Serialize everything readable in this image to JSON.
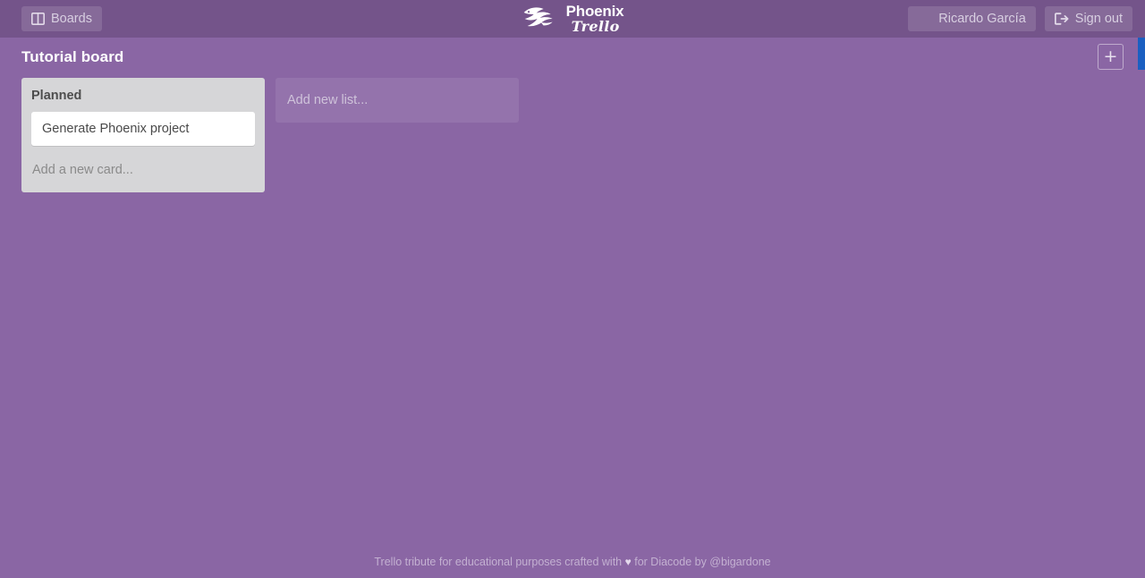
{
  "header": {
    "boards_label": "Boards",
    "boards_icon": "board-columns-icon",
    "logo_phoenix": "Phoenix",
    "logo_trello": "Trello",
    "logo_icon": "phoenix-bird-icon",
    "user_name": "Ricardo García",
    "user_avatar_icon": "user-avatar-photo",
    "signout_label": "Sign out",
    "signout_icon": "sign-out-icon"
  },
  "board": {
    "title": "Tutorial board",
    "members": [
      {
        "name": "member-avatar-1",
        "art": "surf"
      },
      {
        "name": "member-avatar-2",
        "art": "green"
      }
    ],
    "add_member_label": "+"
  },
  "lists": [
    {
      "name": "Planned",
      "cards": [
        {
          "text": "Generate Phoenix project"
        }
      ],
      "add_card_label": "Add a new card..."
    }
  ],
  "add_list_label": "Add new list...",
  "footer": {
    "text_before": "Trello tribute for educational purposes crafted with",
    "heart": "♥",
    "text_after": "for Diacode by @bigardone"
  },
  "colors": {
    "background": "#8a66a4",
    "header": "#74548a",
    "list": "#d6d6d8",
    "card": "#ffffff",
    "scroll_accent": "#1b5fc1"
  }
}
